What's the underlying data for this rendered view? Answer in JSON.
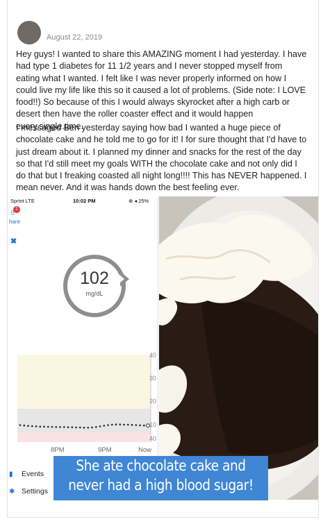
{
  "post": {
    "date": "August 22, 2019",
    "paragraph1": "Hey guys! I wanted to share this AMAZING moment I had yesterday. I have had type 1 diabetes for 11 1/2 years and I never stopped myself from eating what I wanted. I felt like I was never properly informed on how I could live my life like this so it caused a lot of problems. (Side note: I LOVE food!!) So because of this I would always skyrocket after a high carb or desert then have the roller coaster effect and it would happen every.single.time.",
    "paragraph2": "I messaged Ben yesterday saying how bad I wanted a huge piece of chocolate cake and he told me to go for it! I for sure thought that I'd have to just dream about it. I planned my dinner and snacks for the rest of the day so that I'd still meet my goals WITH the chocolate cake and not only did I do that but I freaking coasted all night long!!!! This has NEVER happened. I mean never. And it was hands down the best feeling ever."
  },
  "phone": {
    "carrier": "Sprint  LTE",
    "time": "10:02 PM",
    "battery": "⊕ ◂ 25%",
    "share_badge": "1",
    "share_label": "hare",
    "glucose_value": "102",
    "glucose_unit": "mg/dL",
    "y_ticks": [
      "40",
      "30",
      "20",
      "10",
      "40"
    ],
    "x_ticks": [
      "8PM",
      "9PM",
      "Now"
    ],
    "nav": [
      {
        "label": "Events",
        "icon": "list-icon"
      },
      {
        "label": "Settings",
        "icon": "gear-icon"
      }
    ]
  },
  "chart_data": {
    "type": "scatter",
    "y_ticks": [
      "40",
      "30",
      "20",
      "10",
      "40"
    ],
    "x_ticks": [
      "8PM",
      "9PM",
      "Now"
    ],
    "values": [
      104,
      102,
      100,
      99,
      98,
      97,
      97,
      96,
      96,
      95,
      95,
      95,
      94,
      94,
      93,
      93,
      92,
      92,
      93,
      95,
      98,
      101,
      104,
      106,
      107,
      107,
      106,
      106,
      105,
      104,
      103,
      102,
      102
    ],
    "grid": false
  },
  "banner": {
    "line1": "She ate chocolate cake and",
    "line2": "never had a high blood sugar!"
  },
  "colors": {
    "banner": "#3f86d4",
    "high_zone": "#fbf6e0",
    "target_zone": "#e6e6e6",
    "low_zone": "#fbe3e3",
    "accent": "#1f6fcf"
  }
}
